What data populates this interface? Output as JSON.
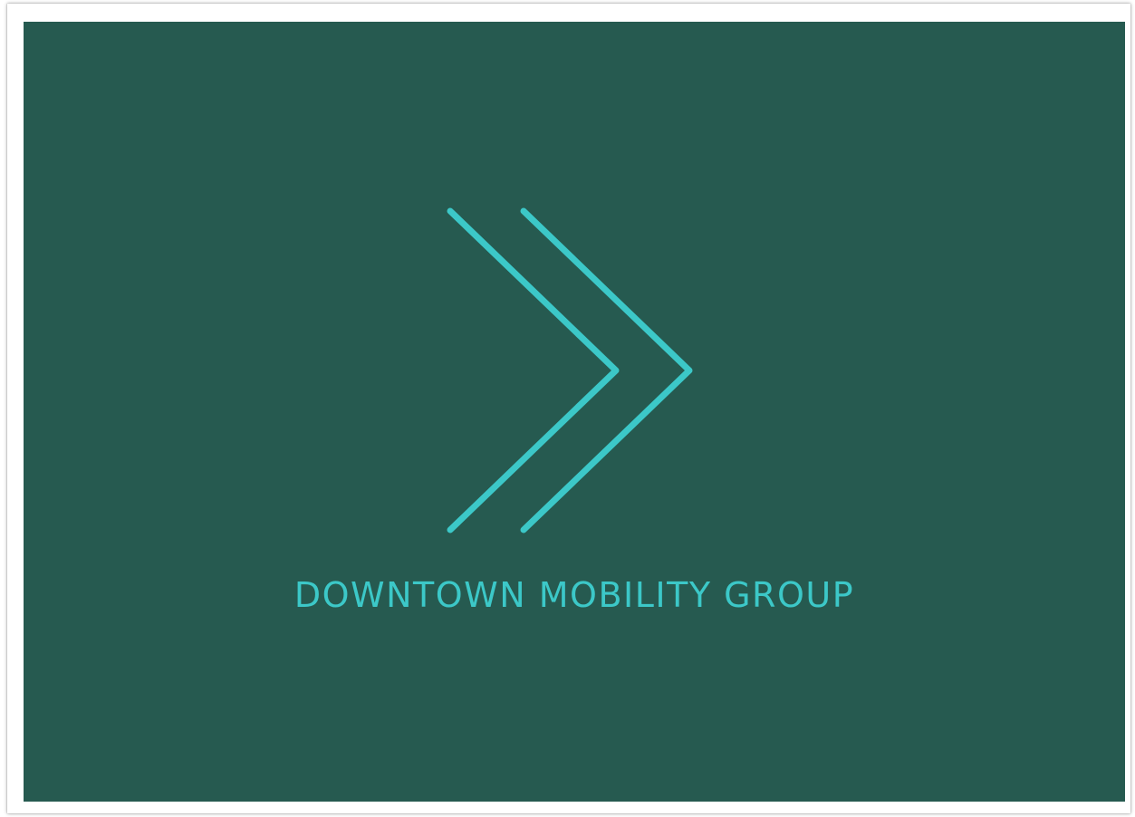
{
  "brand": {
    "name": "DOWNTOWN MOBILITY GROUP",
    "logo_icon": "double-chevron-right-icon"
  },
  "colors": {
    "background": "#265a50",
    "accent": "#3cc8c8",
    "frame": "#ffffff"
  }
}
